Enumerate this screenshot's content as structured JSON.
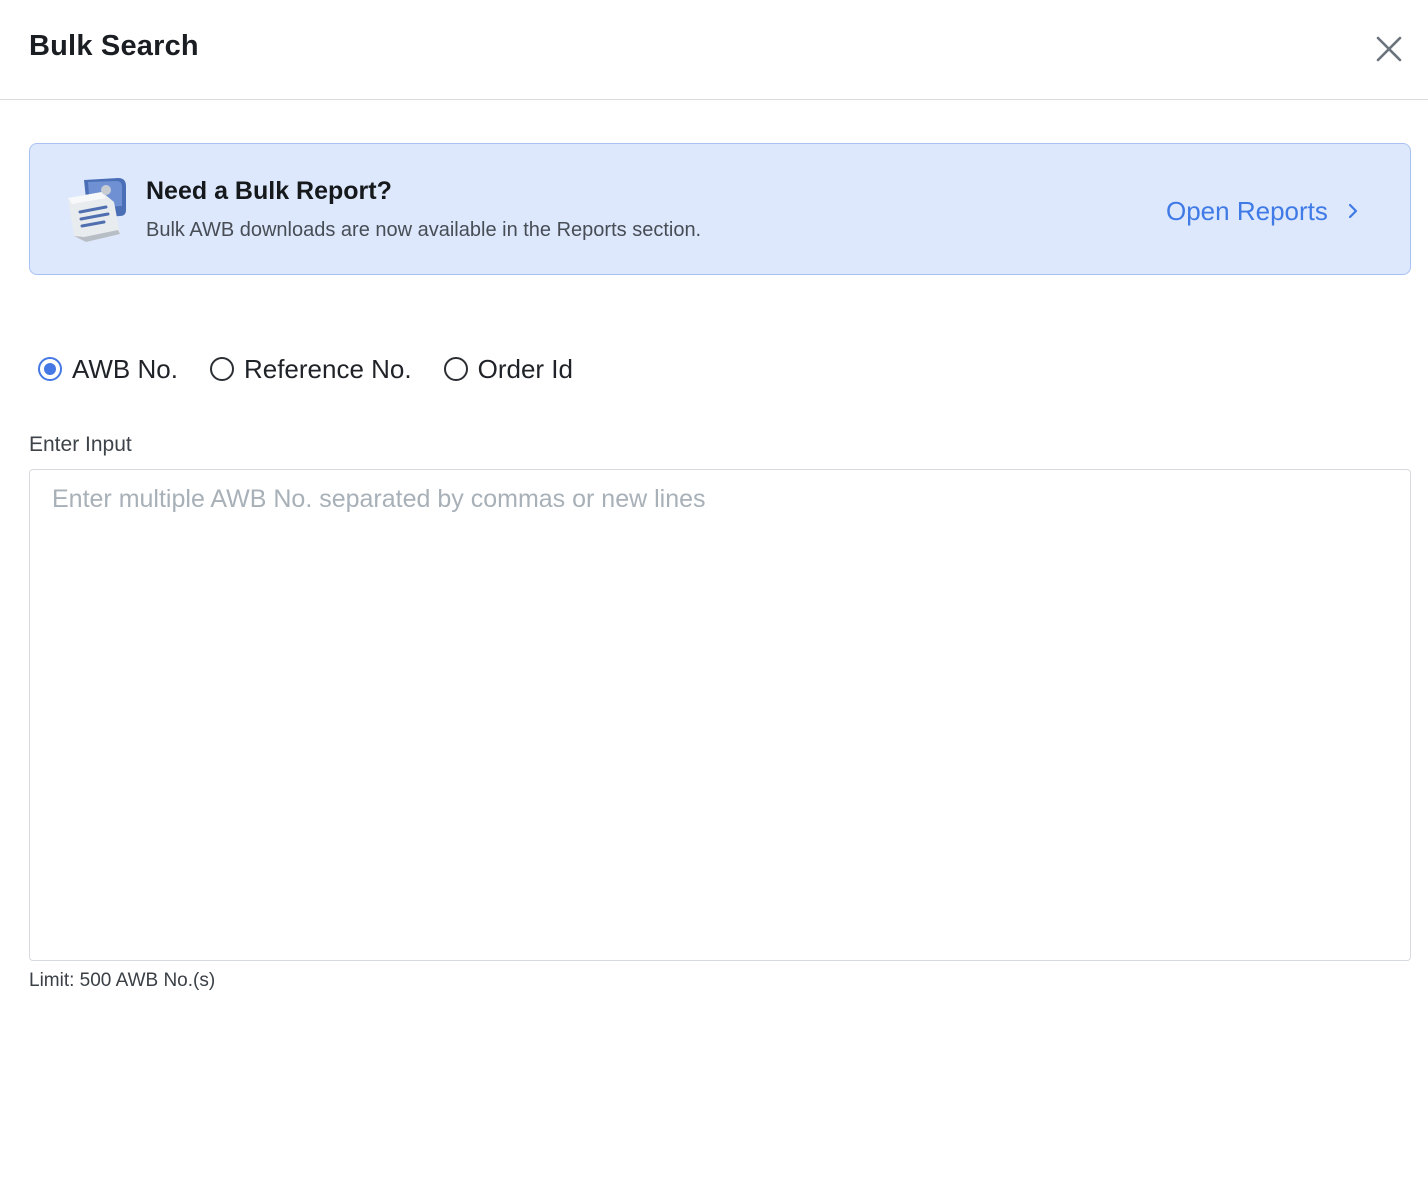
{
  "header": {
    "title": "Bulk Search",
    "close_icon": "close-icon"
  },
  "banner": {
    "icon": "report-document-icon",
    "title": "Need a Bulk Report?",
    "subtitle": "Bulk AWB downloads are now available in the Reports section.",
    "link_label": "Open Reports",
    "link_icon": "chevron-right-icon"
  },
  "search_type": {
    "options": [
      {
        "label": "AWB No.",
        "selected": true
      },
      {
        "label": "Reference No.",
        "selected": false
      },
      {
        "label": "Order Id",
        "selected": false
      }
    ]
  },
  "input": {
    "label": "Enter Input",
    "value": "",
    "placeholder": "Enter multiple AWB No. separated by commas or new lines",
    "limit_text": "Limit: 500 AWB No.(s)"
  },
  "colors": {
    "accent": "#4578e4",
    "link": "#3f7ae6",
    "banner_bg": "#dde8fc",
    "banner_border": "#a9c2f2"
  }
}
